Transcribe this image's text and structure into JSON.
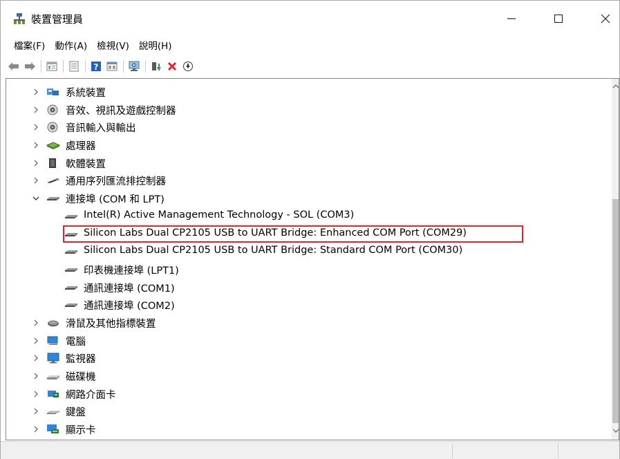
{
  "window": {
    "title": "裝置管理員",
    "minimize_glyph": "—",
    "maximize_glyph": "☐",
    "close_glyph": "✕"
  },
  "menu": [
    {
      "label": "檔案(F)"
    },
    {
      "label": "動作(A)"
    },
    {
      "label": "檢視(V)"
    },
    {
      "label": "說明(H)"
    }
  ],
  "toolbar": [
    "back-icon",
    "forward-icon",
    "properties-icon",
    "update-driver-icon",
    "help-icon",
    "view-icon",
    "scan-hardware-icon",
    "enable-device-icon",
    "uninstall-icon",
    "download-icon"
  ],
  "tree": {
    "items": [
      {
        "label": "系統裝置",
        "level": 0,
        "expanded": false,
        "icon": "system-devices-icon"
      },
      {
        "label": "音效、視訊及遊戲控制器",
        "level": 0,
        "expanded": false,
        "icon": "sound-controller-icon"
      },
      {
        "label": "音訊輸入與輸出",
        "level": 0,
        "expanded": false,
        "icon": "audio-io-icon"
      },
      {
        "label": "處理器",
        "level": 0,
        "expanded": false,
        "icon": "processor-icon"
      },
      {
        "label": "軟體裝置",
        "level": 0,
        "expanded": false,
        "icon": "software-device-icon"
      },
      {
        "label": "通用序列匯流排控制器",
        "level": 0,
        "expanded": false,
        "icon": "usb-controller-icon"
      },
      {
        "label": "連接埠 (COM 和 LPT)",
        "level": 0,
        "expanded": true,
        "icon": "port-icon"
      },
      {
        "label": "Intel(R) Active Management Technology - SOL (COM3)",
        "level": 1,
        "icon": "port-icon"
      },
      {
        "label": "Silicon Labs Dual CP2105 USB to UART Bridge: Enhanced COM Port (COM29)",
        "level": 1,
        "icon": "port-icon",
        "selected": true
      },
      {
        "label": "Silicon Labs Dual CP2105 USB to UART Bridge: Standard COM Port (COM30)",
        "level": 1,
        "icon": "port-icon"
      },
      {
        "label": "印表機連接埠 (LPT1)",
        "level": 1,
        "icon": "port-icon"
      },
      {
        "label": "通訊連接埠 (COM1)",
        "level": 1,
        "icon": "port-icon"
      },
      {
        "label": "通訊連接埠 (COM2)",
        "level": 1,
        "icon": "port-icon"
      },
      {
        "label": "滑鼠及其他指標裝置",
        "level": 0,
        "expanded": false,
        "icon": "mouse-icon"
      },
      {
        "label": "電腦",
        "level": 0,
        "expanded": false,
        "icon": "computer-icon"
      },
      {
        "label": "監視器",
        "level": 0,
        "expanded": false,
        "icon": "monitor-icon"
      },
      {
        "label": "磁碟機",
        "level": 0,
        "expanded": false,
        "icon": "disk-drive-icon"
      },
      {
        "label": "網路介面卡",
        "level": 0,
        "expanded": false,
        "icon": "network-adapter-icon"
      },
      {
        "label": "鍵盤",
        "level": 0,
        "expanded": false,
        "icon": "keyboard-icon"
      },
      {
        "label": "顯示卡",
        "level": 0,
        "expanded": false,
        "icon": "display-adapter-icon"
      }
    ]
  },
  "colors": {
    "selection_border": "#e0242c",
    "port_icon": "#5a5a5a"
  }
}
